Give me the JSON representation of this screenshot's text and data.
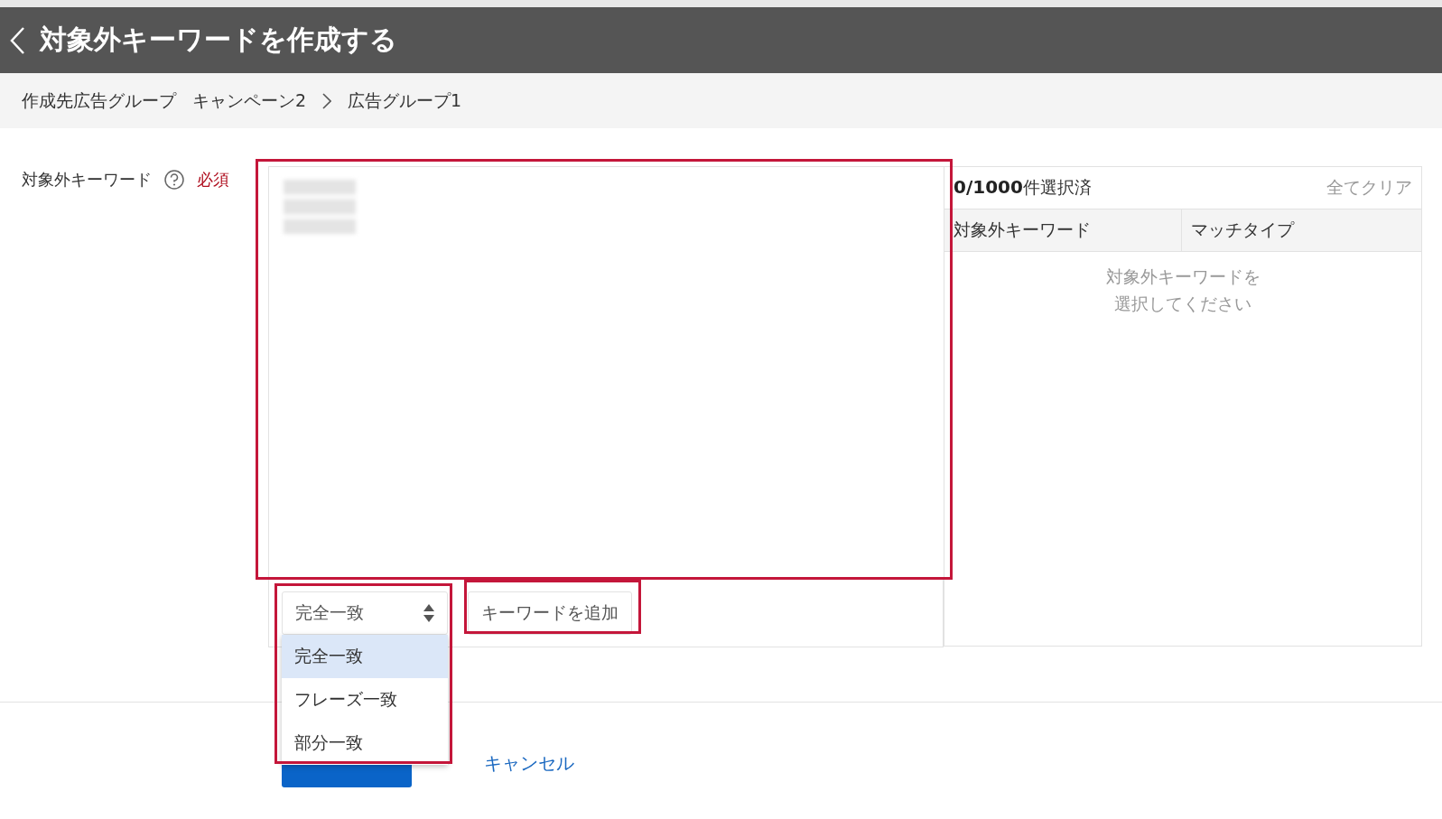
{
  "header": {
    "title": "対象外キーワードを作成する"
  },
  "breadcrumb": {
    "label": "作成先広告グループ",
    "items": [
      "キャンペーン2",
      "広告グループ1"
    ]
  },
  "form": {
    "label": "対象外キーワード",
    "required": "必須",
    "match_select": {
      "value": "完全一致",
      "open": true,
      "options": [
        {
          "label": "完全一致",
          "selected": true
        },
        {
          "label": "フレーズ一致",
          "selected": false
        },
        {
          "label": "部分一致",
          "selected": false
        }
      ]
    },
    "add_button": "キーワードを追加"
  },
  "selection_panel": {
    "count": "0/1000",
    "count_suffix": "件選択済",
    "clear": "全てクリア",
    "columns": [
      "対象外キーワード",
      "マッチタイプ"
    ],
    "empty_message": [
      "対象外キーワードを",
      "選択してください"
    ]
  },
  "footer": {
    "cancel": "キャンセル"
  }
}
